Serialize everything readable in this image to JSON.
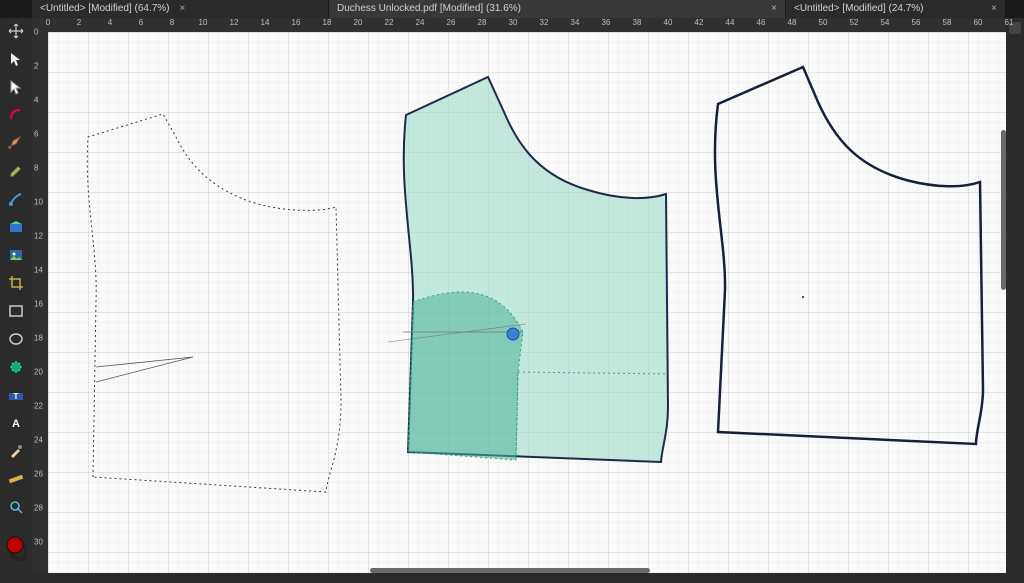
{
  "tabs": [
    {
      "label": "<Untitled> [Modified] (64.7%)"
    },
    {
      "label": "Duchess Unlocked.pdf [Modified] (31.6%)"
    },
    {
      "label": "<Untitled> [Modified] (24.7%)"
    }
  ],
  "ruler": {
    "h": [
      "0",
      "2",
      "4",
      "6",
      "8",
      "10",
      "12",
      "14",
      "16",
      "18",
      "20",
      "22",
      "24",
      "26",
      "28",
      "30",
      "32",
      "34",
      "36",
      "38",
      "40",
      "42",
      "44",
      "46",
      "48",
      "50",
      "52",
      "54",
      "56",
      "58",
      "60",
      "61"
    ],
    "v": [
      "0",
      "2",
      "4",
      "6",
      "8",
      "10",
      "12",
      "14",
      "16",
      "18",
      "20",
      "22",
      "24",
      "26",
      "28",
      "30"
    ]
  },
  "tools": {
    "move": "move-tool",
    "select": "arrow-tool",
    "node": "node-tool",
    "corner": "corner-tool",
    "pen": "pen-tool",
    "pencil": "pencil-tool",
    "brush": "vector-brush",
    "fill": "fill-tool",
    "place": "place-image",
    "crop": "crop-tool",
    "rect": "rectangle-tool",
    "ellipse": "ellipse-tool",
    "star": "star-tool",
    "artistic": "art-text-tool",
    "frame": "frame-text-tool",
    "eyedrop": "color-picker",
    "ruler": "measure-tool",
    "zoom": "zoom-tool"
  },
  "swatches": {
    "fill": "#c00000",
    "stroke": "#000000"
  }
}
